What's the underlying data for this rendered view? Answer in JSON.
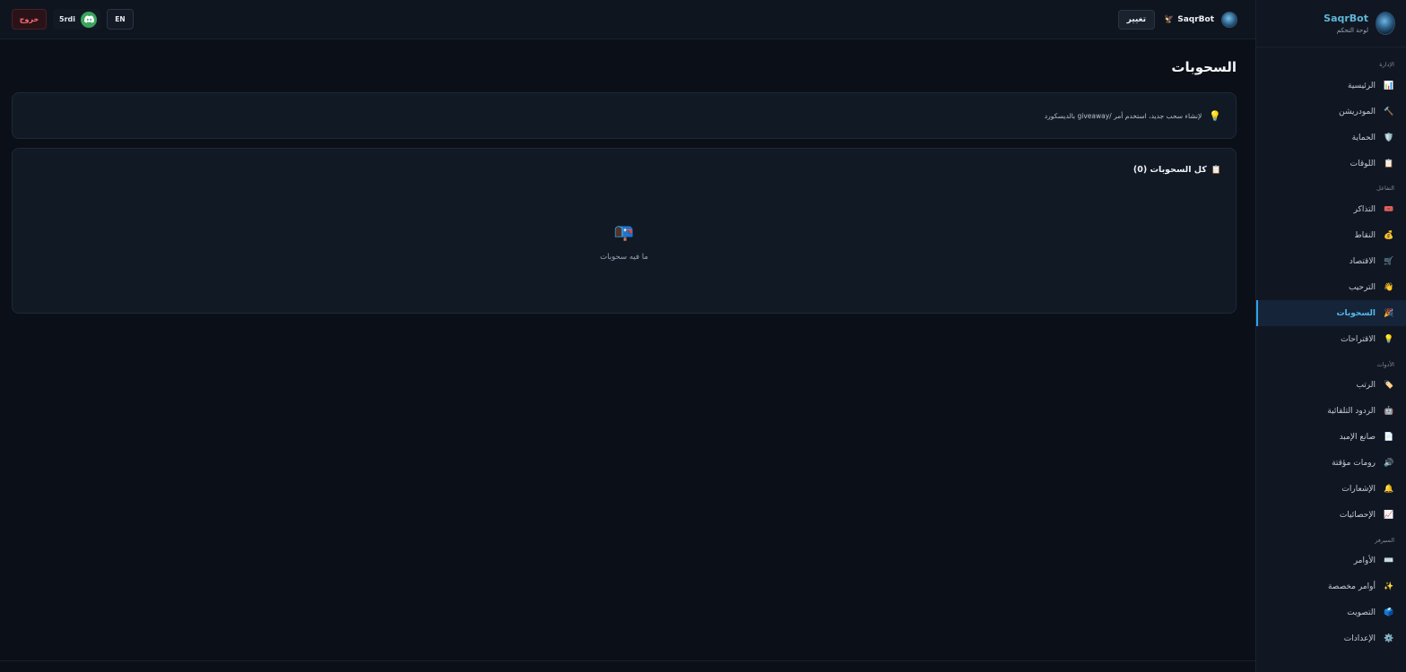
{
  "sidebar": {
    "brand_name": "SaqrBot",
    "brand_sub": "لوحة التحكم",
    "sections": [
      {
        "title": "الإدارة",
        "items": [
          {
            "label": "الرئيسية",
            "icon": "📊",
            "name": "home"
          },
          {
            "label": "المودريشن",
            "icon": "🔨",
            "name": "moderation"
          },
          {
            "label": "الحماية",
            "icon": "🛡️",
            "name": "protection"
          },
          {
            "label": "اللوقات",
            "icon": "📋",
            "name": "logs"
          }
        ]
      },
      {
        "title": "التفاعل",
        "items": [
          {
            "label": "التذاكر",
            "icon": "🎟️",
            "name": "tickets"
          },
          {
            "label": "النقاط",
            "icon": "💰",
            "name": "points"
          },
          {
            "label": "الاقتصاد",
            "icon": "🛒",
            "name": "economy"
          },
          {
            "label": "الترحيب",
            "icon": "👋",
            "name": "welcome"
          },
          {
            "label": "السحوبات",
            "icon": "🎉",
            "name": "giveaways",
            "active": true
          },
          {
            "label": "الاقتراحات",
            "icon": "💡",
            "name": "suggestions"
          }
        ]
      },
      {
        "title": "الأدوات",
        "items": [
          {
            "label": "الرتب",
            "icon": "🏷️",
            "name": "roles"
          },
          {
            "label": "الردود التلقائية",
            "icon": "🤖",
            "name": "auto-replies"
          },
          {
            "label": "صانع الإمبد",
            "icon": "📄",
            "name": "embed-builder"
          },
          {
            "label": "رومات مؤقتة",
            "icon": "🔊",
            "name": "temp-rooms"
          },
          {
            "label": "الإشعارات",
            "icon": "🔔",
            "name": "notifications"
          },
          {
            "label": "الإحصائيات",
            "icon": "📈",
            "name": "statistics"
          }
        ]
      },
      {
        "title": "السيرفر",
        "items": [
          {
            "label": "الأوامر",
            "icon": "⌨️",
            "name": "commands"
          },
          {
            "label": "أوامر مخصصة",
            "icon": "✨",
            "name": "custom-commands"
          },
          {
            "label": "التصويت",
            "icon": "🗳️",
            "name": "voting"
          },
          {
            "label": "الإعدادات",
            "icon": "⚙️",
            "name": "settings"
          }
        ]
      }
    ]
  },
  "topbar": {
    "server_name": "SaqrBot",
    "server_emoji": "🦅",
    "change_label": "تغيير",
    "lang_label": "EN",
    "user_name": "5rdi",
    "logout_label": "خروج"
  },
  "main": {
    "title": "السحوبات",
    "info_icon": "💡",
    "info_text": "لإنشاء سحب جديد، استخدم أمر /giveaway بالديسكورد",
    "list_icon": "📋",
    "list_title": "كل السحوبات (0)",
    "empty_icon": "📭",
    "empty_text": "ما فيه سحوبات"
  },
  "colors": {
    "accent": "#55b8ec",
    "brand": "#5fb6d8",
    "logout": "#ff6b74",
    "discord_green": "#3ba55d"
  }
}
